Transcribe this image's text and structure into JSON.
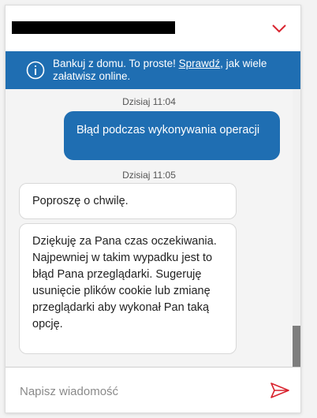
{
  "colors": {
    "brand": "#1f6eb2",
    "accent_red": "#d9232e",
    "background": "#f4f4f4"
  },
  "header": {
    "redacted_title": true,
    "collapse_icon": "chevron-down-icon"
  },
  "banner": {
    "icon": "info-icon",
    "text_before": "Bankuj z domu. To proste! ",
    "link_text": "Sprawdź",
    "text_after": ", jak wiele załatwisz online."
  },
  "conversation": {
    "outgoing_time": "Dzisiaj 11:04",
    "outgoing_message": "Błąd podczas wykonywania operacji",
    "incoming_time": "Dzisiaj 11:05",
    "incoming_messages": [
      "Poproszę o chwilę.",
      "Dziękuję za Pana czas oczekiwania. Najpewniej w takim wypadku jest to błąd Pana przeglądarki. Sugeruję usunięcie plików cookie lub zmianę przeglądarki aby wykonał Pan taką opcję."
    ]
  },
  "composer": {
    "placeholder": "Napisz wiadomość",
    "send_icon": "send-icon"
  }
}
